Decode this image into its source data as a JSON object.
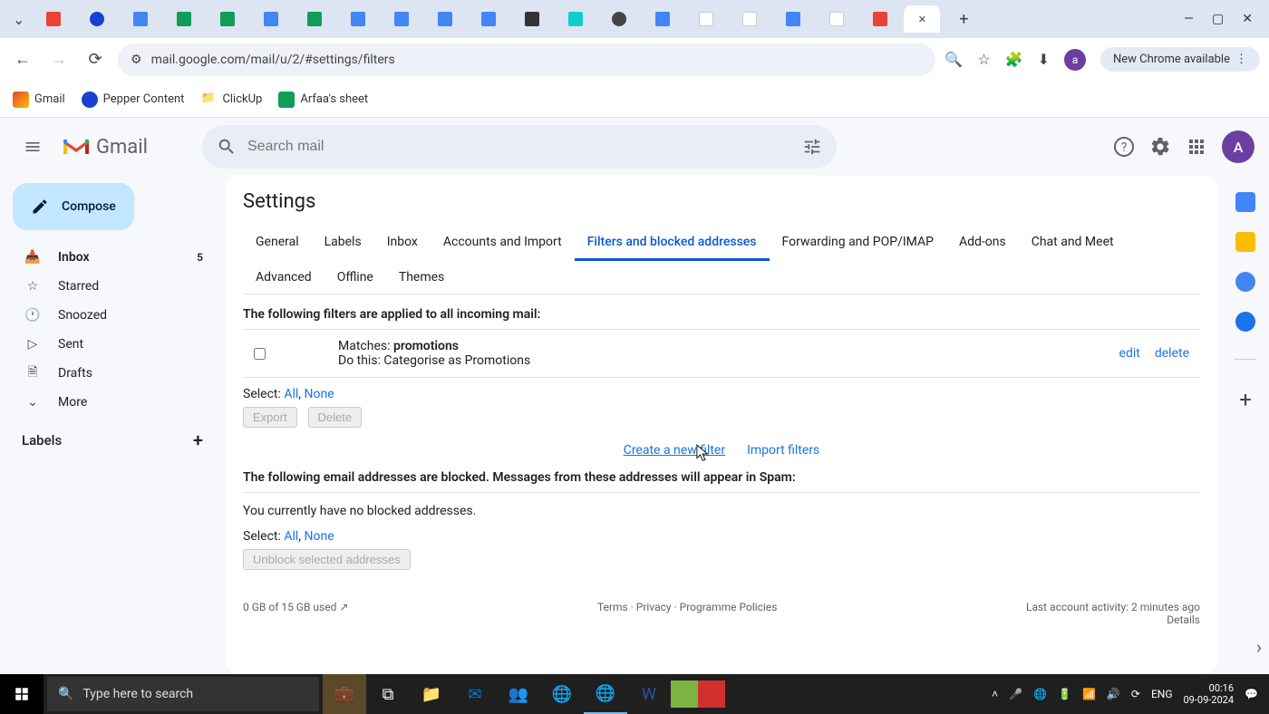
{
  "browser": {
    "url": "mail.google.com/mail/u/2/#settings/filters",
    "update_button": "New Chrome available",
    "window_controls": {
      "minimize": "—",
      "maximize": "▢",
      "close": "✕"
    },
    "tabs_dropdown": "⌄",
    "new_tab": "+"
  },
  "bookmarks": [
    {
      "label": "Gmail",
      "color": "#ea4335"
    },
    {
      "label": "Pepper Content",
      "color": "#1a3fd1"
    },
    {
      "label": "ClickUp",
      "color": "#777"
    },
    {
      "label": "Arfaa's sheet",
      "color": "#0f9d58"
    }
  ],
  "gmail": {
    "brand": "Gmail",
    "search_placeholder": "Search mail",
    "avatar_letter": "A"
  },
  "sidebar": {
    "compose": "Compose",
    "items": [
      {
        "label": "Inbox",
        "count": "5",
        "active": true,
        "icon": "inbox"
      },
      {
        "label": "Starred",
        "icon": "star"
      },
      {
        "label": "Snoozed",
        "icon": "clock"
      },
      {
        "label": "Sent",
        "icon": "send"
      },
      {
        "label": "Drafts",
        "icon": "draft"
      },
      {
        "label": "More",
        "icon": "more"
      }
    ],
    "labels_header": "Labels"
  },
  "settings": {
    "title": "Settings",
    "tabs": [
      "General",
      "Labels",
      "Inbox",
      "Accounts and Import",
      "Filters and blocked addresses",
      "Forwarding and POP/IMAP",
      "Add-ons",
      "Chat and Meet",
      "Advanced",
      "Offline",
      "Themes"
    ],
    "active_tab": 4,
    "filters_header": "The following filters are applied to all incoming mail:",
    "filter": {
      "matches_label": "Matches: ",
      "matches_value": "promotions",
      "action": "Do this: Categorise as Promotions",
      "edit": "edit",
      "delete": "delete"
    },
    "select_label": "Select: ",
    "select_all": "All",
    "select_none": "None",
    "export_btn": "Export",
    "delete_btn": "Delete",
    "create_filter": "Create a new filter",
    "import_filters": "Import filters",
    "blocked_header": "The following email addresses are blocked. Messages from these addresses will appear in Spam:",
    "no_blocked": "You currently have no blocked addresses.",
    "unblock_btn": "Unblock selected addresses"
  },
  "footer": {
    "storage": "0 GB of 15 GB used",
    "terms": "Terms",
    "privacy": "Privacy",
    "policies": "Programme Policies",
    "activity": "Last account activity: 2 minutes ago",
    "details": "Details"
  },
  "taskbar": {
    "search_placeholder": "Type here to search",
    "lang": "ENG",
    "time": "00:16",
    "date": "09-09-2024"
  }
}
